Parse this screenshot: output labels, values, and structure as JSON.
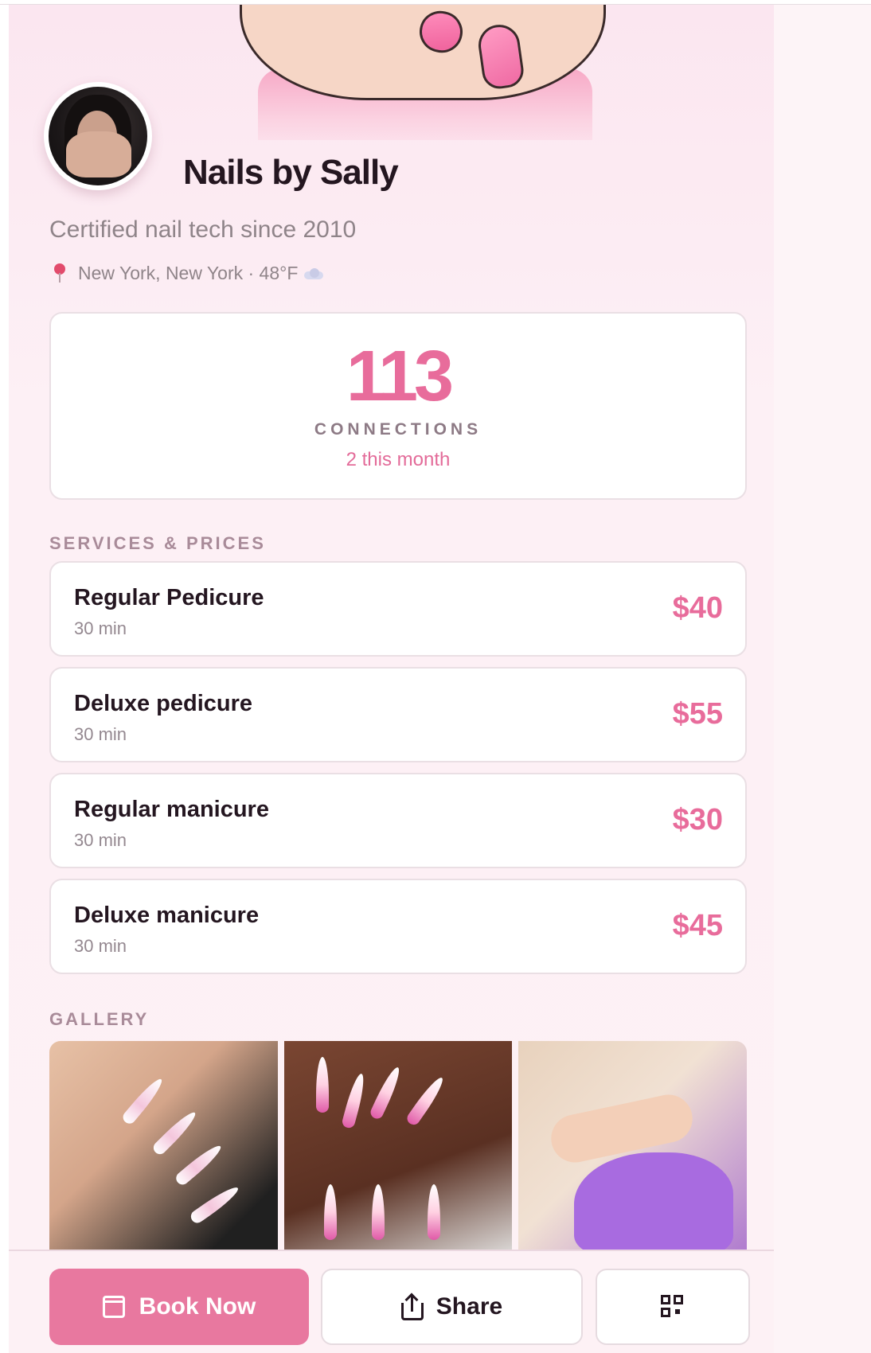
{
  "profile": {
    "name": "Nails by Sally",
    "tagline": "Certified nail tech since 2010",
    "location": "New York, New York · 48°F",
    "weather_icon": "cloud-icon"
  },
  "stats": {
    "count": "113",
    "label": "CONNECTIONS",
    "sub": "2 this month"
  },
  "services_title": "SERVICES & PRICES",
  "services": [
    {
      "name": "Regular Pedicure",
      "duration": "30 min",
      "price": "$40"
    },
    {
      "name": "Deluxe pedicure",
      "duration": "30 min",
      "price": "$55"
    },
    {
      "name": "Regular manicure",
      "duration": "30 min",
      "price": "$30"
    },
    {
      "name": "Deluxe manicure",
      "duration": "30 min",
      "price": "$45"
    }
  ],
  "gallery_title": "GALLERY",
  "actions": {
    "book": "Book Now",
    "share": "Share"
  },
  "colors": {
    "accent": "#e86c9b",
    "button": "#e8789f",
    "text": "#241620"
  }
}
